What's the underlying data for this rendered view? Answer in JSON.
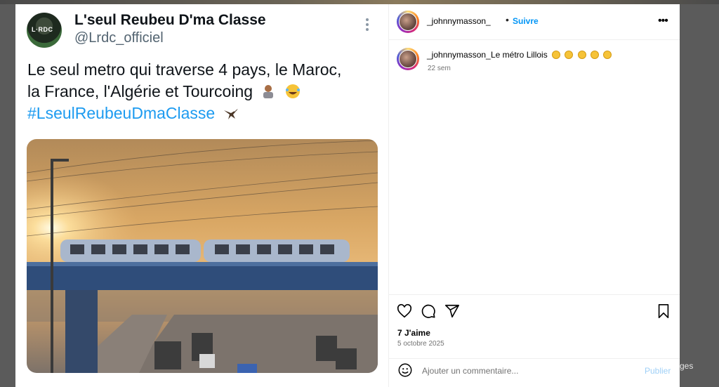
{
  "tweet": {
    "name": "L'seul Reubeu D'ma Classe",
    "handle": "@Lrdc_officiel",
    "avatar_text": "L·RDC",
    "line1": "Le seul metro qui traverse 4 pays, le Maroc,",
    "line2": "la France, l'Algérie et Tourcoing",
    "hashtag": "#LseulReubeuDmaClasse",
    "line2_emojis": [
      "person-shrugging-emoji",
      "laughing-crying-emoji"
    ],
    "hashtag_emoji": "eagle-emoji"
  },
  "post": {
    "username": "_johnnymasson_",
    "follow_label": "Suivre",
    "caption_user": "_johnnymasson_",
    "caption_text": "Le métro Lillois",
    "caption_emojis": [
      "upside-down-face-emoji",
      "rofl-emoji",
      "rofl-emoji",
      "rofl-emoji",
      "rofl-emoji"
    ],
    "time_ago": "22 sem",
    "likes": "7 J'aime",
    "date": "5 octobre 2025",
    "comment_placeholder": "Ajouter un commentaire...",
    "publish_label": "Publier"
  },
  "background": {
    "right_partial_text": "ges"
  },
  "colors": {
    "link_blue": "#0095f6",
    "publish_disabled": "#9fd0f7",
    "hashtag_blue": "#1d9bf0",
    "muted": "#737373"
  }
}
